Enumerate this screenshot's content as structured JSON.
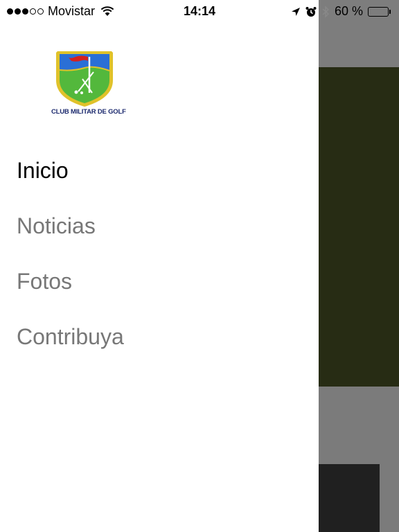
{
  "status_bar": {
    "signal_filled": 3,
    "signal_total": 5,
    "carrier": "Movistar",
    "time": "14:14",
    "battery_text": "60 %",
    "battery_level": 0.6
  },
  "logo": {
    "caption": "CLUB MILITAR DE GOLF"
  },
  "menu": {
    "items": [
      {
        "label": "Inicio",
        "active": true
      },
      {
        "label": "Noticias",
        "active": false
      },
      {
        "label": "Fotos",
        "active": false
      },
      {
        "label": "Contribuya",
        "active": false
      }
    ]
  },
  "colors": {
    "active_text": "#000000",
    "inactive_text": "#777777",
    "crest_sky": "#2a6fd6",
    "crest_grass": "#53b83c",
    "crest_border": "#e0c22a",
    "flag": "#d42020"
  }
}
